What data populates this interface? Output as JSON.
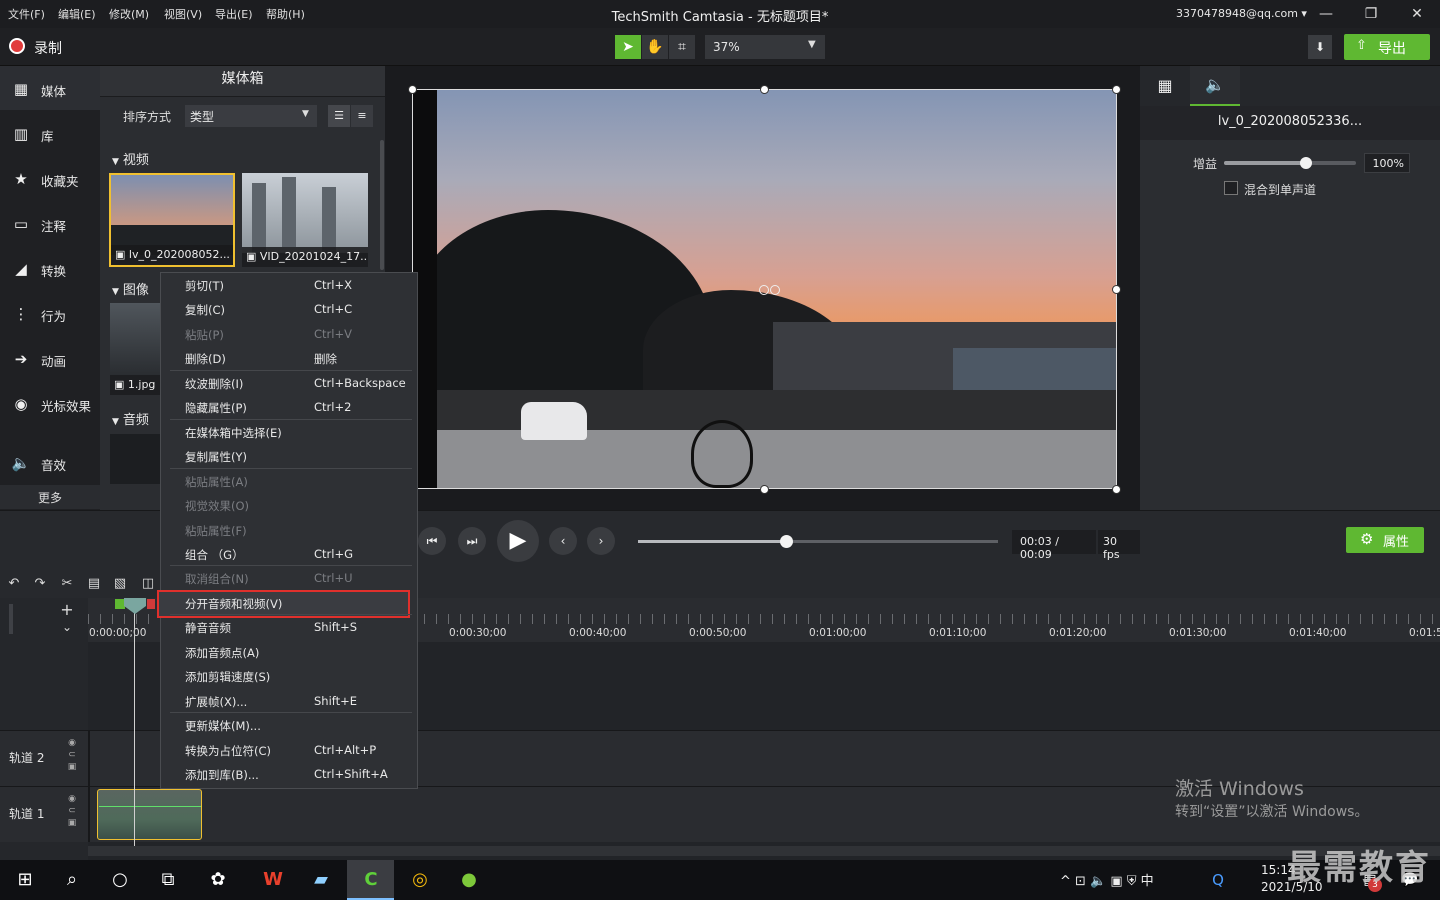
{
  "menu": [
    "文件(F)",
    "编辑(E)",
    "修改(M)",
    "视图(V)",
    "导出(E)",
    "帮助(H)"
  ],
  "window_title": "TechSmith Camtasia - 无标题项目*",
  "account": "3370478948@qq.com ▾",
  "window_controls": [
    "—",
    "❐",
    "✕"
  ],
  "toolbar": {
    "record_label": "录制",
    "zoom": "37%",
    "export_label": "导出"
  },
  "nav": [
    {
      "label": "媒体",
      "icon": "film-icon",
      "glyph": "▦"
    },
    {
      "label": "库",
      "icon": "library-icon",
      "glyph": "▥"
    },
    {
      "label": "收藏夹",
      "icon": "star-icon",
      "glyph": "★"
    },
    {
      "label": "注释",
      "icon": "annotation-icon",
      "glyph": "▭"
    },
    {
      "label": "转换",
      "icon": "transition-icon",
      "glyph": "◢"
    },
    {
      "label": "行为",
      "icon": "behavior-icon",
      "glyph": "⋮"
    },
    {
      "label": "动画",
      "icon": "animation-icon",
      "glyph": "➔"
    },
    {
      "label": "光标效果",
      "icon": "cursor-icon",
      "glyph": "◉"
    },
    {
      "label": "音效",
      "icon": "audio-icon",
      "glyph": "🔈"
    }
  ],
  "nav_more": "更多",
  "bin": {
    "title": "媒体箱",
    "sort_label": "排序方式",
    "sort_value": "类型",
    "sections": {
      "video": "视频",
      "image": "图像",
      "audio": "音频"
    },
    "thumbs": [
      "lv_0_202008052...",
      "VID_20201024_17...",
      "1.jpg"
    ]
  },
  "props": {
    "title": "lv_0_202008052336...",
    "gain_label": "增益",
    "gain_value": "100%",
    "gain_fraction": 0.62,
    "mono_label": "混合到单声道"
  },
  "playback": {
    "time": "00:03 / 00:09",
    "fps": "30 fps",
    "progress": 0.41,
    "props_button": "属性"
  },
  "timeline": {
    "ticks": [
      "0:00:00;00",
      "0:00:30;00",
      "0:00:40;00",
      "0:00:50;00",
      "0:01:00;00",
      "0:01:10;00",
      "0:01:20;00",
      "0:01:30;00",
      "0:01:40;00",
      "0:01:5"
    ],
    "track2": "轨道 2",
    "track1": "轨道 1"
  },
  "context_menu": [
    {
      "label": "剪切(T)",
      "shortcut": "Ctrl+X",
      "disabled": false
    },
    {
      "label": "复制(C)",
      "shortcut": "Ctrl+C",
      "disabled": false
    },
    {
      "label": "粘贴(P)",
      "shortcut": "Ctrl+V",
      "disabled": true
    },
    {
      "label": "删除(D)",
      "shortcut": "删除",
      "disabled": false
    },
    {
      "label": "纹波删除(I)",
      "shortcut": "Ctrl+Backspace",
      "disabled": false
    },
    {
      "label": "隐藏属性(P)",
      "shortcut": "Ctrl+2",
      "disabled": false
    },
    {
      "label": "在媒体箱中选择(E)",
      "shortcut": "",
      "disabled": false
    },
    {
      "label": "复制属性(Y)",
      "shortcut": "",
      "disabled": false
    },
    {
      "label": "粘贴属性(A)",
      "shortcut": "",
      "disabled": true
    },
    {
      "label": "视觉效果(O)",
      "shortcut": "",
      "disabled": true
    },
    {
      "label": "粘贴属性(F)",
      "shortcut": "",
      "disabled": true
    },
    {
      "label": "组合 （G）",
      "shortcut": "Ctrl+G",
      "disabled": false
    },
    {
      "label": "取消组合(N)",
      "shortcut": "Ctrl+U",
      "disabled": true
    },
    {
      "label": "分开音频和视频(V)",
      "shortcut": "",
      "disabled": false
    },
    {
      "label": "静音音频",
      "shortcut": "Shift+S",
      "disabled": false
    },
    {
      "label": "添加音频点(A)",
      "shortcut": "",
      "disabled": false
    },
    {
      "label": "添加剪辑速度(S)",
      "shortcut": "",
      "disabled": false
    },
    {
      "label": "扩展帧(X)...",
      "shortcut": "Shift+E",
      "disabled": false
    },
    {
      "label": "更新媒体(M)...",
      "shortcut": "",
      "disabled": false
    },
    {
      "label": "转换为占位符(C)",
      "shortcut": "Ctrl+Alt+P",
      "disabled": false
    },
    {
      "label": "添加到库(B)...",
      "shortcut": "Ctrl+Shift+A",
      "disabled": false
    }
  ],
  "watermark": {
    "line1": "激活 Windows",
    "line2": "转到“设置”以激活 Windows。",
    "brand": "最需教育"
  },
  "taskbar": {
    "tray": "^ ⊡ 🔈 ▣ ⛨ 中",
    "tray_input": "中",
    "time": "15:14",
    "date": "2021/5/10",
    "notif_count": "3"
  },
  "colors": {
    "accent": "#5fb832",
    "highlight": "#e0302c",
    "selection": "#f0c030"
  }
}
